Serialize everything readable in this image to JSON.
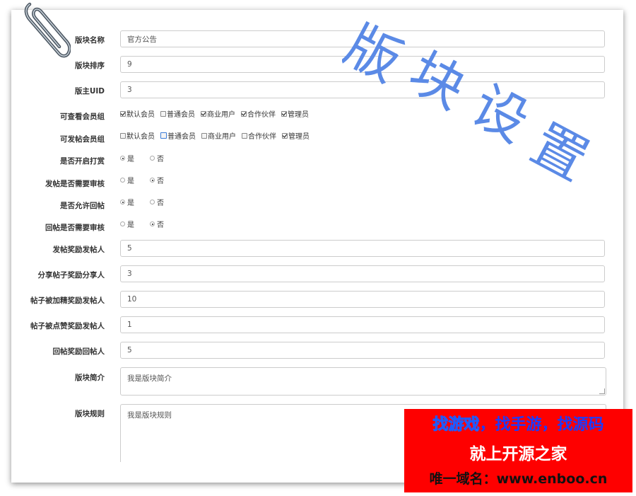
{
  "form": {
    "block_name": {
      "label": "版块名称",
      "value": "官方公告"
    },
    "block_order": {
      "label": "版块排序",
      "value": "9"
    },
    "moderator_uid": {
      "label": "版主UID",
      "value": "3"
    },
    "view_groups": {
      "label": "可查看会员组",
      "options": [
        {
          "label": "默认会员",
          "checked": true
        },
        {
          "label": "普通会员",
          "checked": false
        },
        {
          "label": "商业用户",
          "checked": true
        },
        {
          "label": "合作伙伴",
          "checked": true
        },
        {
          "label": "管理员",
          "checked": true
        }
      ]
    },
    "post_groups": {
      "label": "可发帖会员组",
      "options": [
        {
          "label": "默认会员",
          "checked": false
        },
        {
          "label": "普通会员",
          "checked": false,
          "focused": true
        },
        {
          "label": "商业用户",
          "checked": false
        },
        {
          "label": "合作伙伴",
          "checked": false
        },
        {
          "label": "管理员",
          "checked": true
        }
      ]
    },
    "enable_tips": {
      "label": "是否开启打赏",
      "yes": "是",
      "no": "否",
      "selected": "是"
    },
    "post_review": {
      "label": "发帖是否需要审核",
      "yes": "是",
      "no": "否",
      "selected": "否"
    },
    "allow_reply": {
      "label": "是否允许回帖",
      "yes": "是",
      "no": "否",
      "selected": "是"
    },
    "reply_review": {
      "label": "回帖是否需要审核",
      "yes": "是",
      "no": "否",
      "selected": "否"
    },
    "post_reward": {
      "label": "发帖奖励发帖人",
      "value": "5"
    },
    "share_reward": {
      "label": "分享帖子奖励分享人",
      "value": "3"
    },
    "featured_reward": {
      "label": "帖子被加精奖励发帖人",
      "value": "10"
    },
    "like_reward": {
      "label": "帖子被点赞奖励发帖人",
      "value": "1"
    },
    "reply_reward": {
      "label": "回帖奖励回帖人",
      "value": "5"
    },
    "block_intro": {
      "label": "版块简介",
      "value": "我是版块简介"
    },
    "block_rules": {
      "label": "版块规则",
      "value": "我是版块规则"
    }
  },
  "watermark": {
    "text": "版块设置",
    "color": "#5b8ae6"
  },
  "ad_banner": {
    "line1_a": "找游戏",
    "line1_b": "，找手游，找源码",
    "line2": "就上开源之家",
    "line3": "唯一域名：www.enboo.cn",
    "background": "#fe0000"
  }
}
